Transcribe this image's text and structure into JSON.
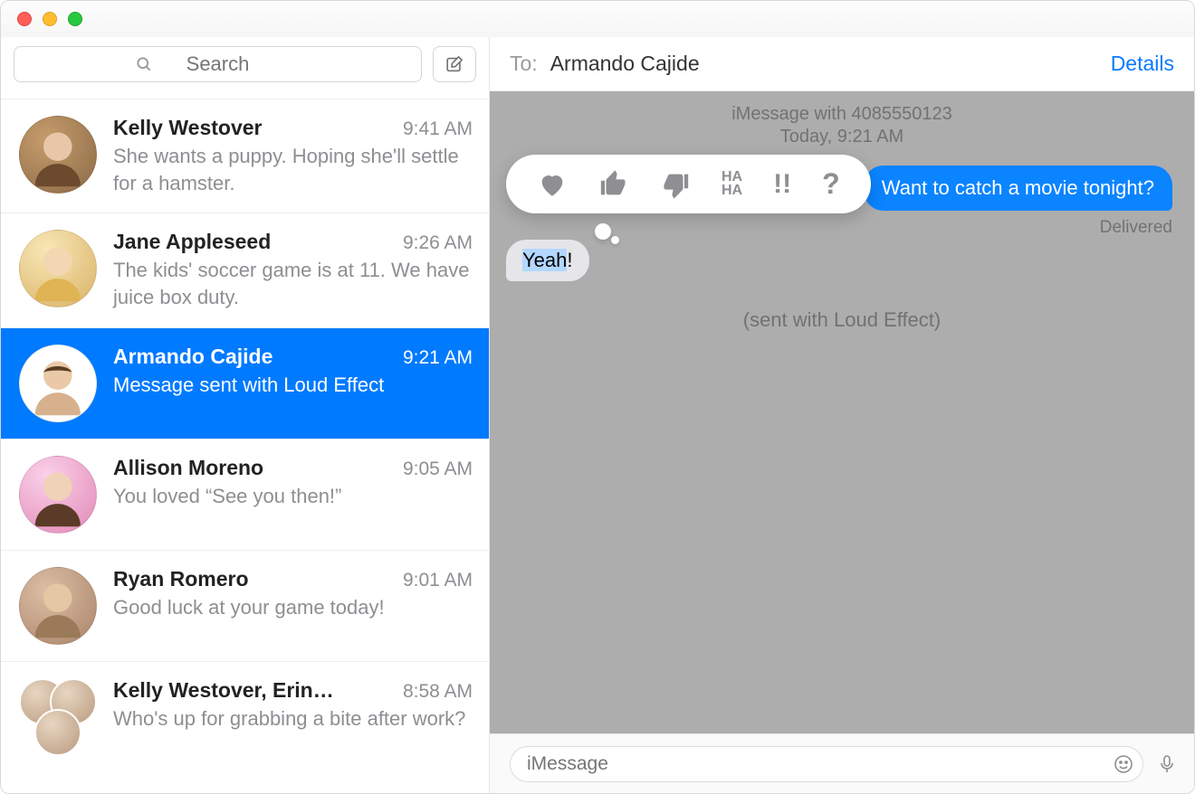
{
  "search": {
    "placeholder": "Search"
  },
  "sidebar": {
    "items": [
      {
        "name": "Kelly Westover",
        "time": "9:41 AM",
        "preview": "She wants a puppy. Hoping she'll settle for a hamster."
      },
      {
        "name": "Jane Appleseed",
        "time": "9:26 AM",
        "preview": "The kids' soccer game is at 11. We have juice box duty."
      },
      {
        "name": "Armando Cajide",
        "time": "9:21 AM",
        "preview": "Message sent with Loud Effect"
      },
      {
        "name": "Allison Moreno",
        "time": "9:05 AM",
        "preview": "You loved “See you then!”"
      },
      {
        "name": "Ryan Romero",
        "time": "9:01 AM",
        "preview": "Good luck at your game today!"
      },
      {
        "name": "Kelly Westover, Erin…",
        "time": "8:58 AM",
        "preview": "Who's up for grabbing a bite after work?"
      }
    ]
  },
  "header": {
    "to_label": "To:",
    "to_name": "Armando Cajide",
    "details": "Details"
  },
  "chat": {
    "status_main": "iMessage with 4085550123",
    "status_sub": "Today, 9:21 AM",
    "outgoing": "Want to catch a movie tonight?",
    "delivered": "Delivered",
    "incoming_a": "Yeah",
    "incoming_b": "!",
    "effect": "(sent with Loud Effect)"
  },
  "tapback": {
    "haha": "HA\nHA",
    "bang": "!!",
    "question": "?"
  },
  "compose": {
    "placeholder": "iMessage"
  }
}
